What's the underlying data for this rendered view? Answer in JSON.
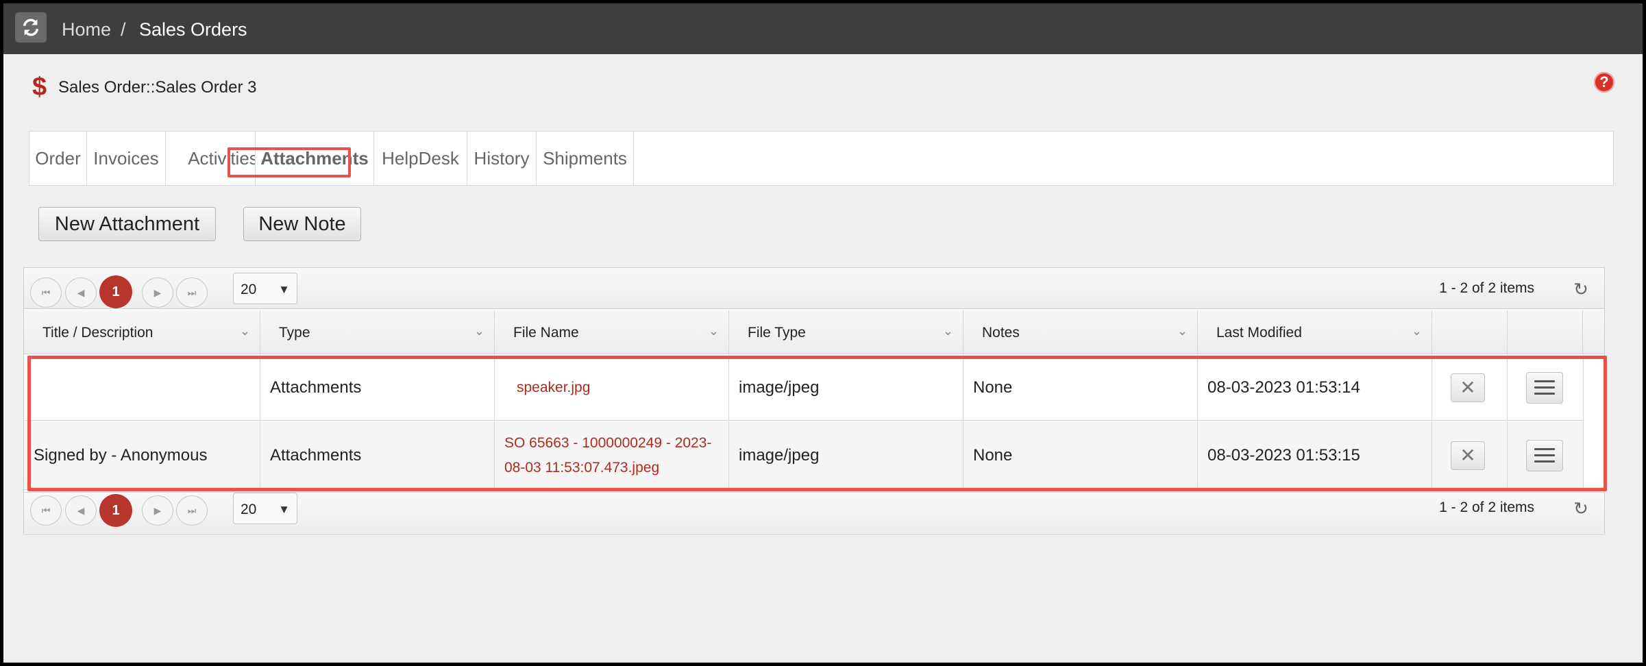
{
  "breadcrumb": {
    "home": "Home",
    "separator": "/",
    "current": "Sales Orders"
  },
  "record": {
    "icon": "dollar-icon",
    "title": "Sales Order::Sales Order 3"
  },
  "help": {
    "icon": "help-icon",
    "glyph": "?"
  },
  "tabs": [
    {
      "label": "Order"
    },
    {
      "label": "Invoices"
    },
    {
      "label": "Activities"
    },
    {
      "label": "Attachments",
      "active": true
    },
    {
      "label": "HelpDesk"
    },
    {
      "label": "History"
    },
    {
      "label": "Shipments"
    }
  ],
  "actions": {
    "new_attachment": "New Attachment",
    "new_note": "New Note"
  },
  "pager": {
    "current_page": "1",
    "page_size": "20",
    "info": "1 - 2 of 2 items"
  },
  "columns": [
    "Title / Description",
    "Type",
    "File Name",
    "File Type",
    "Notes",
    "Last Modified"
  ],
  "rows": [
    {
      "title": "",
      "type": "Attachments",
      "file_name": "speaker.jpg",
      "file_type": "image/jpeg",
      "notes": "None",
      "last_modified": "08-03-2023 01:53:14"
    },
    {
      "title": "Signed by - Anonymous",
      "type": "Attachments",
      "file_name_line1": "SO 65663 - 1000000249 - 2023-",
      "file_name_line2": "08-03 11:53:07.473.jpeg",
      "file_type": "image/jpeg",
      "notes": "None",
      "last_modified": "08-03-2023 01:53:15"
    }
  ],
  "colors": {
    "accent": "#b8352d",
    "highlight": "#e9524a",
    "topbar": "#3f3e3d"
  }
}
